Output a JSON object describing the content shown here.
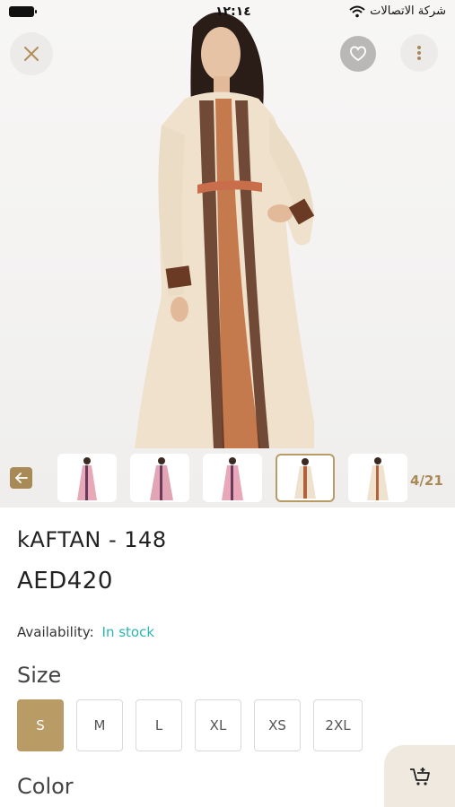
{
  "status_bar": {
    "time": "١٢:١٤",
    "carrier": "شركة الاتصالات"
  },
  "top_actions": {
    "close_icon": "close-icon",
    "favorite_icon": "heart-icon",
    "more_icon": "more-vertical-icon"
  },
  "gallery": {
    "counter": "4/21",
    "back_icon": "arrow-left-icon",
    "thumbnails": [
      {
        "dress_color": "#e7a9b8"
      },
      {
        "dress_color": "#e2a5b6"
      },
      {
        "dress_color": "#e8a8ba"
      },
      {
        "dress_color": "#eee2cf"
      },
      {
        "dress_color": "#efe3d0"
      }
    ],
    "active_index": 3
  },
  "product": {
    "title": "kAFTAN - 148",
    "price": "AED420",
    "availability_label": "Availability:",
    "availability_value": "In stock"
  },
  "size": {
    "label": "Size",
    "options": [
      "S",
      "M",
      "L",
      "XL",
      "XS",
      "2XL"
    ],
    "selected": "S"
  },
  "color": {
    "label": "Color"
  },
  "cart_button": {
    "icon": "add-to-cart-icon"
  },
  "colors": {
    "accent": "#b99b66",
    "stock": "#2bb6b2"
  }
}
